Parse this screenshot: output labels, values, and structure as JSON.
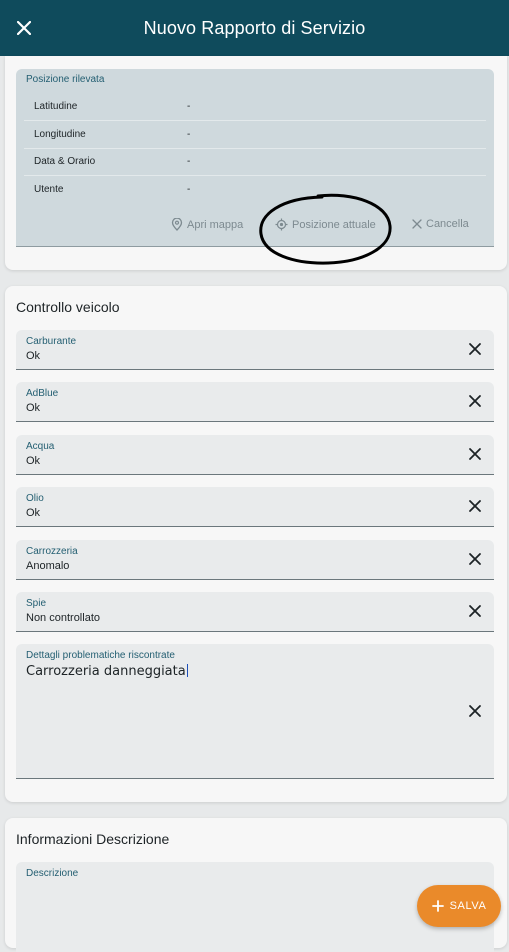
{
  "header": {
    "title": "Nuovo Rapporto di Servizio",
    "close_icon": "close-icon",
    "bg_color": "#0f4b5c"
  },
  "position": {
    "label": "Posizione rilevata",
    "rows": [
      {
        "key": "Latitudine",
        "value": "-"
      },
      {
        "key": "Longitudine",
        "value": "-"
      },
      {
        "key": "Data & Orario",
        "value": "-"
      },
      {
        "key": "Utente",
        "value": "-"
      }
    ],
    "actions": {
      "open_map": "Apri mappa",
      "current_position": "Posizione attuale",
      "cancel": "Cancella"
    }
  },
  "vehicle_check": {
    "title": "Controllo veicolo",
    "fields": [
      {
        "label": "Carburante",
        "value": "Ok"
      },
      {
        "label": "AdBlue",
        "value": "Ok"
      },
      {
        "label": "Acqua",
        "value": "Ok"
      },
      {
        "label": "Olio",
        "value": "Ok"
      },
      {
        "label": "Carrozzeria",
        "value": "Anomalo"
      },
      {
        "label": "Spie",
        "value": "Non controllato"
      }
    ],
    "details": {
      "label": "Dettagli problematiche riscontrate",
      "value": "Carrozzeria danneggiata"
    }
  },
  "description": {
    "title": "Informazioni Descrizione",
    "field_label": "Descrizione"
  },
  "fab": {
    "label": "SALVA",
    "icon": "plus-icon",
    "color": "#ea8a2a"
  },
  "annotation": {
    "shape": "hand-drawn circle around current position action",
    "color": "#000000"
  }
}
